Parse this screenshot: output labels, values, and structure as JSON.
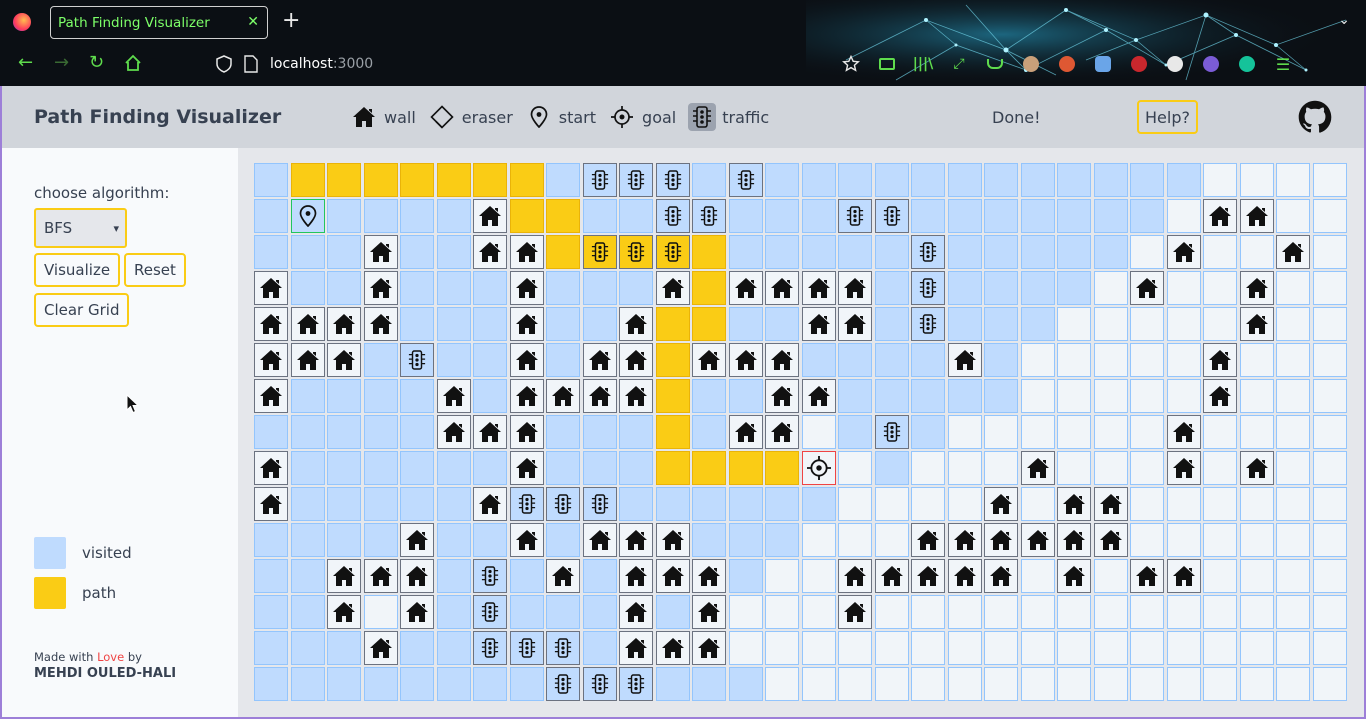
{
  "browser": {
    "tab_title": "Path Finding Visualizer",
    "url_host": "localhost",
    "url_port": ":3000",
    "accent_color": "#5fdc4d"
  },
  "header": {
    "title": "Path Finding Visualizer",
    "tools": [
      {
        "id": "wall",
        "label": "wall",
        "icon": "house-icon",
        "active": false
      },
      {
        "id": "eraser",
        "label": "eraser",
        "icon": "eraser-icon",
        "active": false
      },
      {
        "id": "start",
        "label": "start",
        "icon": "map-pin-icon",
        "active": false
      },
      {
        "id": "goal",
        "label": "goal",
        "icon": "crosshair-icon",
        "active": false
      },
      {
        "id": "traffic",
        "label": "traffic",
        "icon": "traffic-light-icon",
        "active": true
      }
    ],
    "status": "Done!",
    "help_label": "Help?"
  },
  "sidebar": {
    "algorithm_label": "choose algorithm:",
    "algorithm_selected": "BFS",
    "visualize_label": "Visualize",
    "reset_label": "Reset",
    "clear_label": "Clear Grid",
    "legend": [
      {
        "label": "visited",
        "color": "#bfdbfe"
      },
      {
        "label": "path",
        "color": "#facc15"
      }
    ],
    "credit_prefix": "Made with ",
    "credit_love": "Love",
    "credit_suffix": " by",
    "author": "MEHDI OULED-HALI"
  },
  "grid": {
    "cols": 30,
    "rows": 15,
    "legend_key": {
      "v": "visited",
      ".": "empty",
      "p": "path",
      "W": "wall",
      "T": "traffic",
      "S": "start",
      "G": "goal"
    },
    "cells": [
      "vpppppppvTTTvTvvvvvvvvvvvv....",
      "vSvvvvWppvvTTvvvTTvvvvvvv.WW..",
      "vvvWvvWWpTTTpvvvvvTvvvvv.W..W.",
      "WvvWvvvWvvvWpWWWWvTvvvv.W..W..",
      "WWWWvvvWvvWppvvWWvTvvv.....W..",
      "WWWvTvvWvWWpWWWvvvvWv.....W...",
      "WvvvvWvWWWWpvvWWvvvvv.....W...",
      "vvvvvWWWvvvpvWW.vTv......W....",
      "WvvvvvvWvvvppppG.v...W...W.W..",
      "WvvvvvWTTTvvvvvv....W.WW......",
      "vvvvWvvWvWWWvvv...WWWWWW......",
      "vvWWWvTvWvWWWv..WWWWW.W.WW....",
      "vvW.WvTvvvWvW...W.............",
      "vvvWvvTTTvWWW.................",
      "vvvvvvvvTTTvvv................"
    ]
  }
}
